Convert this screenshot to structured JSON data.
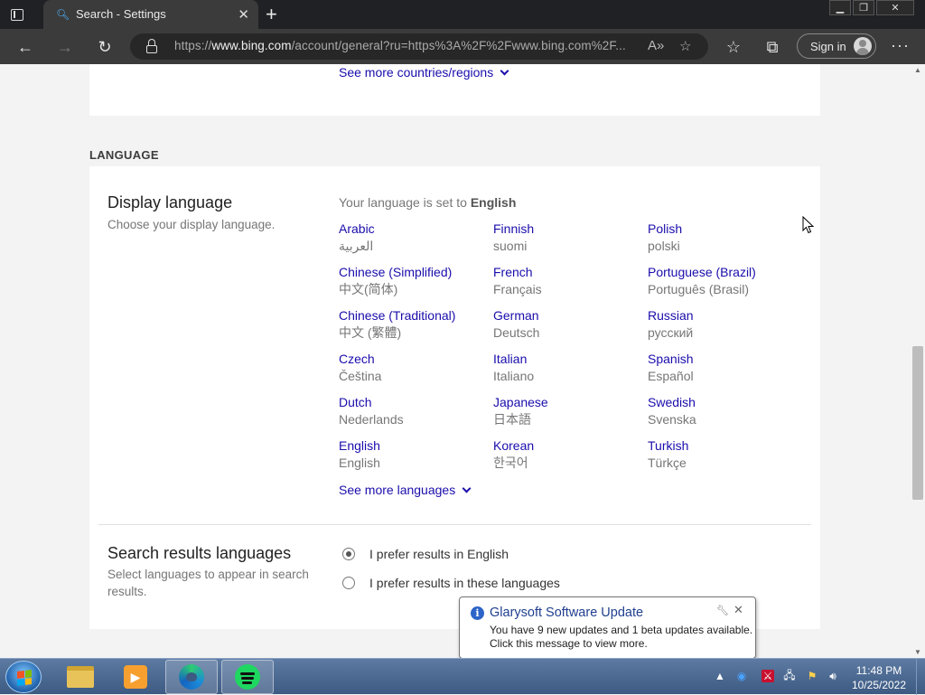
{
  "browser": {
    "tab_title": "Search - Settings",
    "url_prefix": "https://",
    "url_host": "www.bing.com",
    "url_rest": "/account/general?ru=https%3A%2F%2Fwww.bing.com%2F...",
    "signin_label": "Sign in"
  },
  "page": {
    "see_more_countries": "See more countries/regions",
    "section_language": "LANGUAGE",
    "display_language": {
      "title": "Display language",
      "description": "Choose your display language.",
      "set_to_prefix": "Your language is set to ",
      "set_to_value": "English",
      "languages": [
        {
          "name": "Arabic",
          "native": "العربية"
        },
        {
          "name": "Finnish",
          "native": "suomi"
        },
        {
          "name": "Polish",
          "native": "polski"
        },
        {
          "name": "Chinese (Simplified)",
          "native": "中文(简体)"
        },
        {
          "name": "French",
          "native": "Français"
        },
        {
          "name": "Portuguese (Brazil)",
          "native": "Português (Brasil)"
        },
        {
          "name": "Chinese (Traditional)",
          "native": "中文 (繁體)"
        },
        {
          "name": "German",
          "native": "Deutsch"
        },
        {
          "name": "Russian",
          "native": "русский"
        },
        {
          "name": "Czech",
          "native": "Čeština"
        },
        {
          "name": "Italian",
          "native": "Italiano"
        },
        {
          "name": "Spanish",
          "native": "Español"
        },
        {
          "name": "Dutch",
          "native": "Nederlands"
        },
        {
          "name": "Japanese",
          "native": "日本語"
        },
        {
          "name": "Swedish",
          "native": "Svenska"
        },
        {
          "name": "English",
          "native": "English"
        },
        {
          "name": "Korean",
          "native": "한국어"
        },
        {
          "name": "Turkish",
          "native": "Türkçe"
        }
      ],
      "see_more_languages": "See more languages"
    },
    "search_results_languages": {
      "title": "Search results languages",
      "description": "Select languages to appear in search results.",
      "option_english": "I prefer results in English",
      "option_these": "I prefer results in these languages",
      "selected": "english"
    }
  },
  "notification": {
    "title": "Glarysoft Software Update",
    "line1": "You have 9 new updates and 1 beta updates available.",
    "line2": "Click this message to view more."
  },
  "taskbar": {
    "time": "11:48 PM",
    "date": "10/25/2022"
  },
  "colors": {
    "link": "#1a0dab",
    "browser_dark": "#202124",
    "toolbar": "#3b3b3b"
  }
}
